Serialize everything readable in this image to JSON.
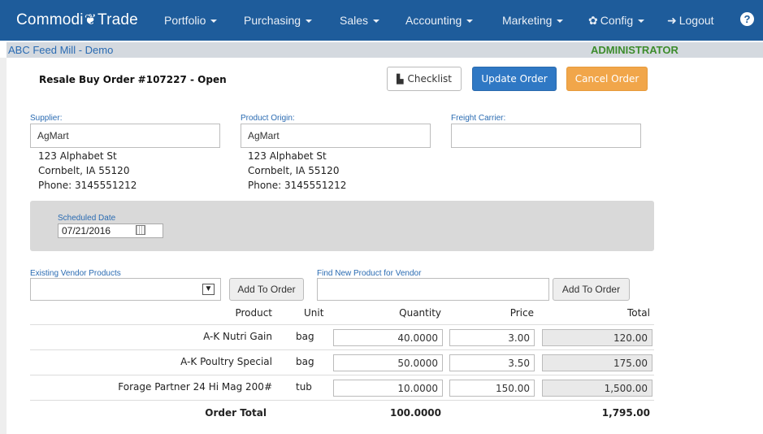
{
  "navbar": {
    "brand_left": "Commodi",
    "brand_icon": "wheat-icon",
    "brand_right": "Trade",
    "items": [
      {
        "label": "Portfolio"
      },
      {
        "label": "Purchasing"
      },
      {
        "label": "Sales"
      },
      {
        "label": "Accounting"
      },
      {
        "label": "Marketing"
      },
      {
        "label": "Config"
      },
      {
        "label": "Logout"
      }
    ],
    "help_glyph": "?"
  },
  "subbar": {
    "company": "ABC Feed Mill - Demo",
    "role": "ADMINISTRATOR"
  },
  "order": {
    "title": "Resale Buy Order #107227 - Open",
    "checklist_label": "Checklist",
    "update_label": "Update Order",
    "cancel_label": "Cancel Order"
  },
  "supplier": {
    "label": "Supplier:",
    "value": "AgMart",
    "address1": "123 Alphabet St",
    "address2": "Cornbelt, IA 55120",
    "phone": "Phone: 3145551212"
  },
  "origin": {
    "label": "Product Origin:",
    "value": "AgMart",
    "address1": "123 Alphabet St",
    "address2": "Cornbelt, IA 55120",
    "phone": "Phone: 3145551212"
  },
  "carrier": {
    "label": "Freight Carrier:",
    "value": ""
  },
  "schedule": {
    "label": "Scheduled Date",
    "value": "07/21/2016"
  },
  "existing_products": {
    "label": "Existing Vendor Products",
    "selected": "",
    "add_label": "Add To Order"
  },
  "find_product": {
    "label": "Find New Product for Vendor",
    "value": "",
    "add_label": "Add To Order"
  },
  "grid": {
    "headers": {
      "product": "Product",
      "unit": "Unit",
      "quantity": "Quantity",
      "price": "Price",
      "total": "Total"
    },
    "rows": [
      {
        "product": "A-K Nutri Gain",
        "unit": "bag",
        "quantity": "40.0000",
        "price": "3.00",
        "total": "120.00"
      },
      {
        "product": "A-K Poultry Special",
        "unit": "bag",
        "quantity": "50.0000",
        "price": "3.50",
        "total": "175.00"
      },
      {
        "product": "Forage Partner 24 Hi Mag 200#",
        "unit": "tub",
        "quantity": "10.0000",
        "price": "150.00",
        "total": "1,500.00"
      }
    ],
    "footer": {
      "label": "Order Total",
      "quantity": "100.0000",
      "total": "1,795.00"
    }
  }
}
